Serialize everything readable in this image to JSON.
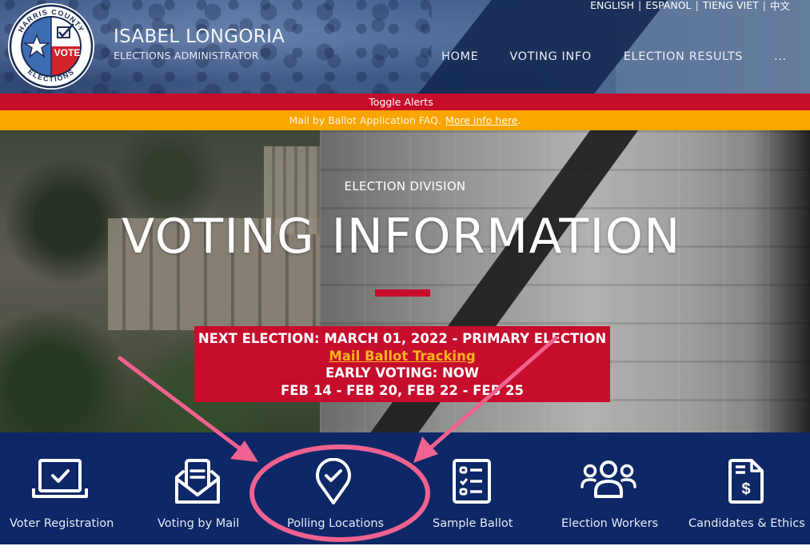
{
  "header": {
    "logo": {
      "top_text": "HARRIS COUNTY",
      "bottom_text": "ELECTIONS",
      "badge_text": "VOTE"
    },
    "brand_name": "ISABEL LONGORIA",
    "brand_subtitle": "ELECTIONS ADMINISTRATOR",
    "languages": [
      "ENGLISH",
      "ESPANOL",
      "TIENG VIET",
      "中文"
    ],
    "nav": {
      "home": "HOME",
      "voting_info": "VOTING INFO",
      "election_results": "ELECTION RESULTS",
      "more": "..."
    }
  },
  "alerts": {
    "toggle_label": "Toggle Alerts",
    "message": "Mail by Ballot Application FAQ.",
    "link_text": "More info here",
    "link_suffix": "."
  },
  "hero": {
    "kicker": "ELECTION DIVISION",
    "title": "VOTING INFORMATION",
    "election_box": {
      "next_election": "NEXT ELECTION: MARCH 01, 2022 - PRIMARY ELECTION",
      "tracking_link": "Mail Ballot Tracking",
      "early_voting": "EARLY VOTING: NOW",
      "dates": "FEB 14 - FEB 20, FEB 22 - FEB 25"
    }
  },
  "quick_links": [
    {
      "label": "Voter Registration",
      "icon": "laptop-check-icon"
    },
    {
      "label": "Voting by Mail",
      "icon": "mail-envelope-icon"
    },
    {
      "label": "Polling Locations",
      "icon": "map-pin-check-icon"
    },
    {
      "label": "Sample Ballot",
      "icon": "checklist-icon"
    },
    {
      "label": "Election Workers",
      "icon": "people-group-icon"
    },
    {
      "label": "Candidates & Ethics",
      "icon": "document-dollar-icon"
    }
  ],
  "colors": {
    "brand_red": "#c60d2c",
    "alert_yellow": "#fba501",
    "navy": "#0d2767",
    "link_gold": "#f9b31b",
    "annotation_pink": "#f0628f"
  }
}
